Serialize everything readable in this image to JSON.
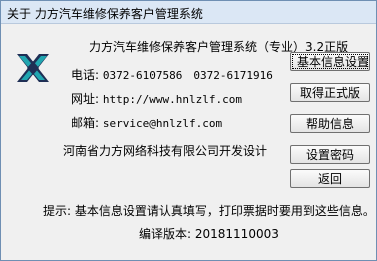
{
  "window": {
    "title": "关于 力方汽车维修保养客户管理系统"
  },
  "header": {
    "product": "力方汽车维修保养客户管理系统（专业）3.2正版"
  },
  "contact": {
    "phone_label": "电话:",
    "phone_value": "0372-6107586　0372-6171916",
    "web_label": "网址:",
    "web_value": "http://www.hnlzlf.com",
    "email_label": "邮箱:",
    "email_value": "service@hnlzlf.com"
  },
  "company": "河南省力方网络科技有限公司开发设计",
  "hint": "提示: 基本信息设置请认真填写，打印票据时要用到这些信息。",
  "version": {
    "label": "编译版本:",
    "value": "20181110003"
  },
  "buttons": {
    "basic_info": "基本信息设置",
    "get_official": "取得正式版",
    "help": "帮助信息",
    "set_password": "设置密码",
    "back": "返回"
  },
  "icons": {
    "logo": "lifang-logo-icon"
  },
  "colors": {
    "logo_dark": "#1f2f55",
    "logo_teal": "#21a6b0"
  }
}
